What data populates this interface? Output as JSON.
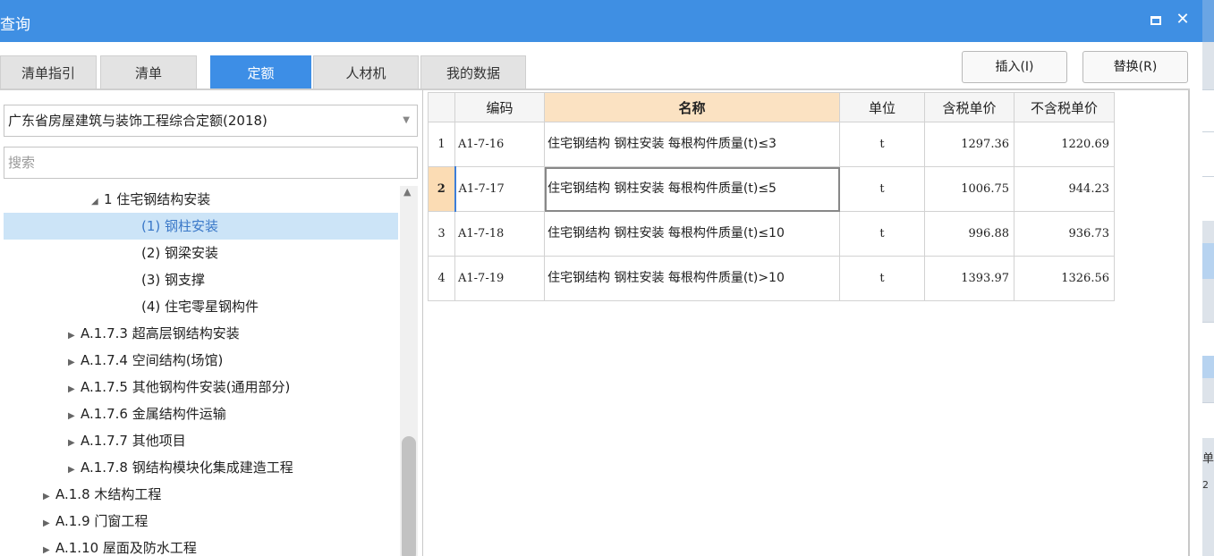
{
  "window": {
    "title": "查询",
    "maximize_icon": "maximize-icon",
    "close_icon": "close-icon",
    "close_glyph": "✕"
  },
  "tabs": [
    {
      "label": "清单指引",
      "active": false
    },
    {
      "label": "清单",
      "active": false
    },
    {
      "label": "定额",
      "active": true
    },
    {
      "label": "人材机",
      "active": false
    },
    {
      "label": "我的数据",
      "active": false
    }
  ],
  "actions": {
    "insert_label": "插入(I)",
    "replace_label": "替换(R)"
  },
  "left_panel": {
    "quota_library": "广东省房屋建筑与装饰工程综合定额(2018)",
    "search_placeholder": "搜索",
    "tree": [
      {
        "toggle": "◢",
        "label": "1 住宅钢结构安装",
        "selected": false
      },
      {
        "toggle": "",
        "label": "(1) 钢柱安装",
        "selected": true
      },
      {
        "toggle": "",
        "label": "(2) 钢梁安装",
        "selected": false
      },
      {
        "toggle": "",
        "label": "(3) 钢支撑",
        "selected": false
      },
      {
        "toggle": "",
        "label": "(4) 住宅零星钢构件",
        "selected": false
      },
      {
        "toggle": "▶",
        "label": "A.1.7.3 超高层钢结构安装",
        "selected": false
      },
      {
        "toggle": "▶",
        "label": "A.1.7.4 空间结构(场馆)",
        "selected": false
      },
      {
        "toggle": "▶",
        "label": "A.1.7.5 其他钢构件安装(通用部分)",
        "selected": false
      },
      {
        "toggle": "▶",
        "label": "A.1.7.6 金属结构件运输",
        "selected": false
      },
      {
        "toggle": "▶",
        "label": "A.1.7.7 其他项目",
        "selected": false
      },
      {
        "toggle": "▶",
        "label": "A.1.7.8 钢结构模块化集成建造工程",
        "selected": false
      },
      {
        "toggle": "▶",
        "label": "A.1.8 木结构工程",
        "selected": false
      },
      {
        "toggle": "▶",
        "label": "A.1.9 门窗工程",
        "selected": false
      },
      {
        "toggle": "▶",
        "label": "A.1.10 屋面及防水工程",
        "selected": false
      }
    ]
  },
  "grid": {
    "headers": [
      "",
      "编码",
      "名称",
      "单位",
      "含税单价",
      "不含税单价"
    ],
    "rows": [
      {
        "idx": "1",
        "code": "A1-7-16",
        "name": "住宅钢结构 钢柱安装 每根构件质量(t)≤3",
        "unit": "t",
        "price_tax": "1297.36",
        "price_notax": "1220.69",
        "current": false
      },
      {
        "idx": "2",
        "code": "A1-7-17",
        "name": "住宅钢结构 钢柱安装 每根构件质量(t)≤5",
        "unit": "t",
        "price_tax": "1006.75",
        "price_notax": "944.23",
        "current": true
      },
      {
        "idx": "3",
        "code": "A1-7-18",
        "name": "住宅钢结构 钢柱安装 每根构件质量(t)≤10",
        "unit": "t",
        "price_tax": "996.88",
        "price_notax": "936.73",
        "current": false
      },
      {
        "idx": "4",
        "code": "A1-7-19",
        "name": "住宅钢结构 钢柱安装 每根构件质量(t)>10",
        "unit": "t",
        "price_tax": "1393.97",
        "price_notax": "1326.56",
        "current": false
      }
    ]
  },
  "edge_fragments": {
    "a": "单",
    "b": "2"
  }
}
